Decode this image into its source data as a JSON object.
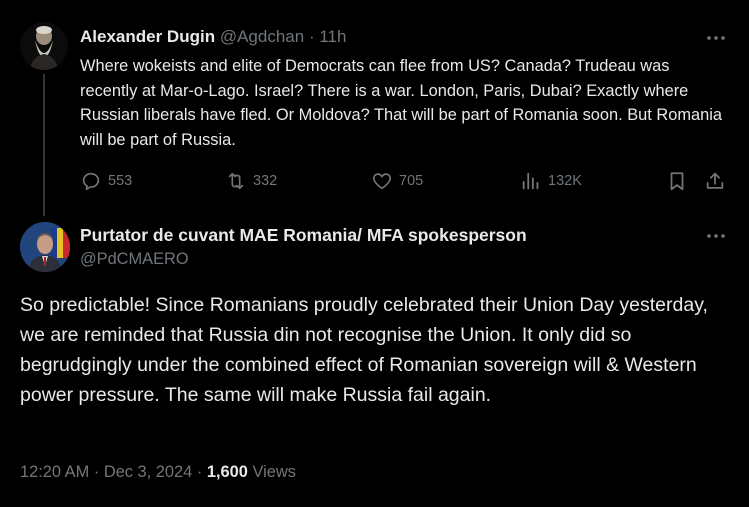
{
  "parent": {
    "author_name": "Alexander Dugin",
    "handle": "@Agdchan",
    "separator": "·",
    "time": "11h",
    "text": "Where wokeists and elite of Democrats can flee from US? Canada? Trudeau was recently at Mar-o-Lago. Israel? There is a war. London, Paris, Dubai? Exactly where Russian liberals have fled. Or Moldova? That will be part of Romania soon. But Romania will be part of Russia.",
    "replies": "553",
    "reposts": "332",
    "likes": "705",
    "views": "132K"
  },
  "main": {
    "author_name": "Purtator de cuvant MAE Romania/ MFA spokesperson",
    "handle": "@PdCMAERO",
    "text": "So predictable! Since Romanians proudly celebrated their Union Day yesterday, we are reminded that Russia din not recognise the Union. It only did so begrudgingly under the combined effect of Romanian sovereign will & Western power pressure. The same will make Russia fail again.",
    "time": "12:20 AM",
    "date": "Dec 3, 2024",
    "separator": "·",
    "views_count": "1,600",
    "views_label": "Views"
  },
  "icons": {
    "more": "more-horizontal-icon",
    "reply": "reply-icon",
    "repost": "repost-icon",
    "like": "heart-icon",
    "views": "analytics-icon",
    "bookmark": "bookmark-icon",
    "share": "share-icon"
  },
  "colors": {
    "background": "#000000",
    "text": "#e7e9ea",
    "muted": "#71767b",
    "thread_line": "#333639"
  }
}
